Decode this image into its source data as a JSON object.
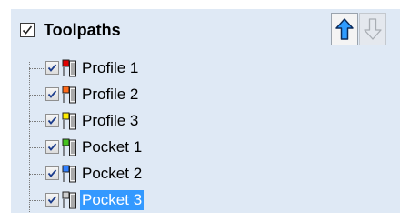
{
  "header": {
    "title": "Toolpaths",
    "checked": true
  },
  "toolbar": {
    "move_up_icon": "arrow-up-icon",
    "move_down_icon": "arrow-down-icon",
    "move_down_enabled": false
  },
  "toolpaths": [
    {
      "label": "Profile 1",
      "checked": true,
      "color": "#e00000",
      "selected": false
    },
    {
      "label": "Profile 2",
      "checked": true,
      "color": "#ff6a1a",
      "selected": false
    },
    {
      "label": "Profile 3",
      "checked": true,
      "color": "#ffee00",
      "selected": false
    },
    {
      "label": "Pocket 1",
      "checked": true,
      "color": "#44c21e",
      "selected": false
    },
    {
      "label": "Pocket 2",
      "checked": true,
      "color": "#2f7fff",
      "selected": false
    },
    {
      "label": "Pocket 3",
      "checked": true,
      "color": "#cfcfcf",
      "selected": true
    }
  ]
}
